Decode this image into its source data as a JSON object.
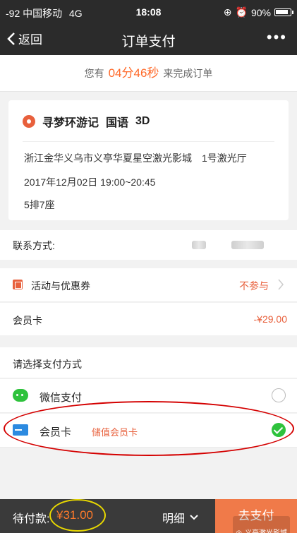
{
  "status_bar": {
    "carrier": "-92 中国移动",
    "network": "4G",
    "time": "18:08",
    "battery": "90%"
  },
  "nav": {
    "back_label": "返回",
    "title": "订单支付",
    "more": "•••"
  },
  "countdown": {
    "prefix": "您有",
    "time": "04分46秒",
    "suffix": "来完成订单"
  },
  "movie": {
    "title": "寻梦环游记",
    "language": "国语",
    "format": "3D",
    "cinema": "浙江金华义乌市义亭华夏星空激光影城　1号激光厅",
    "showtime": "2017年12月02日 19:00~20:45",
    "seat": "5排7座"
  },
  "contact": {
    "label": "联系方式:"
  },
  "discount": {
    "label": "活动与优惠券",
    "value": "不参与"
  },
  "member_card": {
    "label": "会员卡",
    "amount": "-¥29.00"
  },
  "payment": {
    "header": "请选择支付方式",
    "options": [
      {
        "label": "微信支付",
        "sub": "",
        "selected": false
      },
      {
        "label": "会员卡",
        "sub": "储值会员卡",
        "selected": true
      }
    ]
  },
  "bottom_bar": {
    "label": "待付款:",
    "amount": "¥31.00",
    "detail": "明细",
    "pay_button": "去支付",
    "watermark": "义亭激光影城"
  },
  "colors": {
    "accent": "#ff6a2a",
    "dark": "#2b2b2b",
    "wechat_green": "#2ec23c",
    "pay_button": "#f07a49"
  }
}
